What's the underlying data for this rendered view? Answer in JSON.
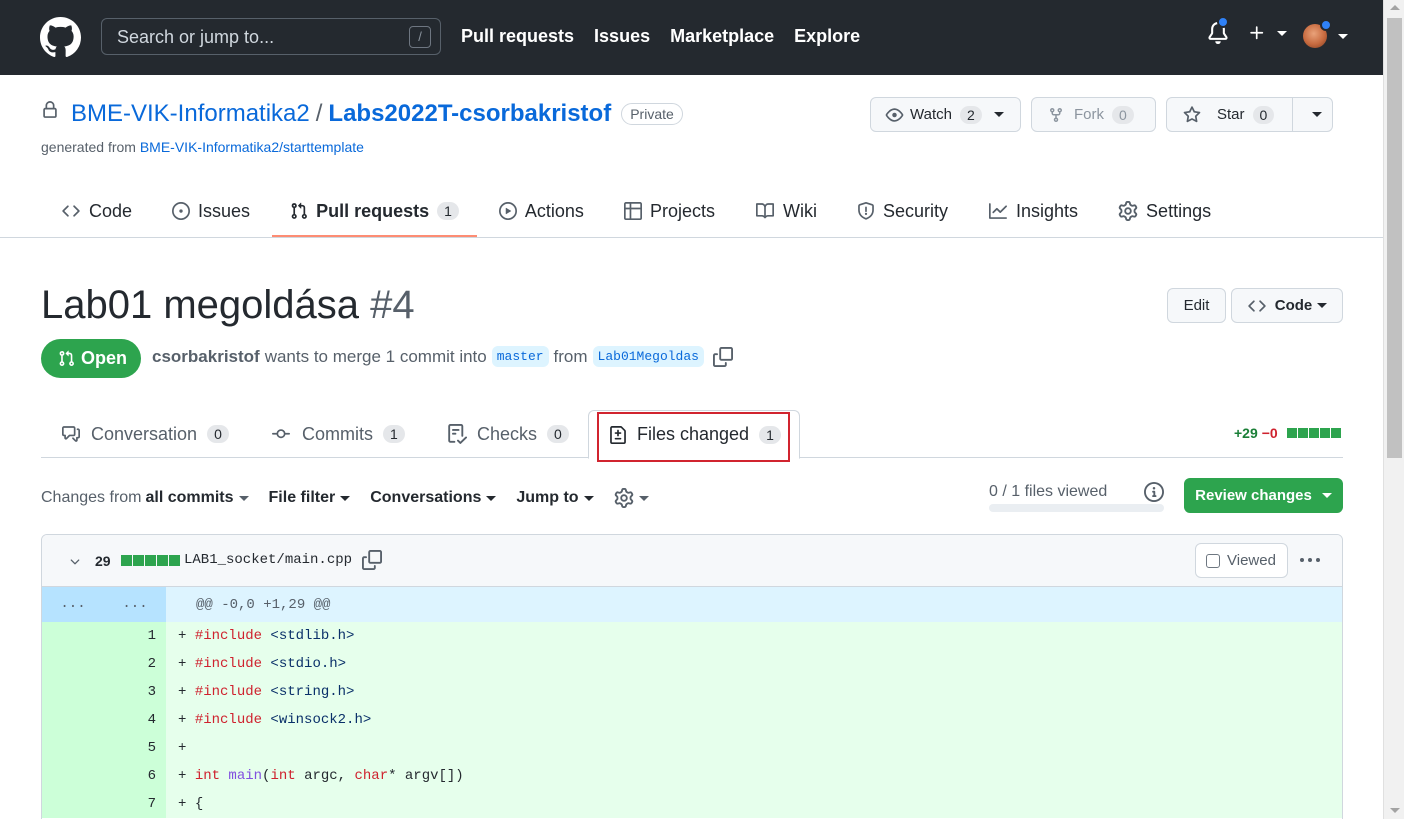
{
  "header": {
    "search_placeholder": "Search or jump to...",
    "slash_key": "/",
    "nav": [
      "Pull requests",
      "Issues",
      "Marketplace",
      "Explore"
    ]
  },
  "repo": {
    "owner": "BME-VIK-Informatika2",
    "separator": "/",
    "name": "Labs2022T-csorbakristof",
    "visibility": "Private",
    "generated_prefix": "generated from",
    "template_link": "BME-VIK-Informatika2/starttemplate",
    "watch_label": "Watch",
    "watch_count": "2",
    "fork_label": "Fork",
    "fork_count": "0",
    "star_label": "Star",
    "star_count": "0"
  },
  "repo_tabs": [
    {
      "label": "Code",
      "icon": "code-icon"
    },
    {
      "label": "Issues",
      "icon": "issue-icon"
    },
    {
      "label": "Pull requests",
      "icon": "pull-request-icon",
      "count": "1",
      "active": true
    },
    {
      "label": "Actions",
      "icon": "play-icon"
    },
    {
      "label": "Projects",
      "icon": "table-icon"
    },
    {
      "label": "Wiki",
      "icon": "book-icon"
    },
    {
      "label": "Security",
      "icon": "shield-icon"
    },
    {
      "label": "Insights",
      "icon": "graph-icon"
    },
    {
      "label": "Settings",
      "icon": "gear-icon"
    }
  ],
  "pr": {
    "title": "Lab01 megoldása",
    "number": "#4",
    "edit_label": "Edit",
    "code_label": "Code",
    "status": "Open",
    "author": "csorbakristof",
    "merge_text": "wants to merge 1 commit into",
    "base_branch": "master",
    "from_text": "from",
    "head_branch": "Lab01Megoldas"
  },
  "pr_tabs": [
    {
      "label": "Conversation",
      "count": "0",
      "icon": "comment-discussion-icon"
    },
    {
      "label": "Commits",
      "count": "1",
      "icon": "commit-icon"
    },
    {
      "label": "Checks",
      "count": "0",
      "icon": "checklist-icon"
    },
    {
      "label": "Files changed",
      "count": "1",
      "icon": "file-diff-icon",
      "active": true
    }
  ],
  "diffstat": {
    "additions": "+29",
    "deletions": "−0"
  },
  "toolbar": {
    "changes_prefix": "Changes from",
    "changes_value": "all commits",
    "file_filter": "File filter",
    "conversations": "Conversations",
    "jump_to": "Jump to",
    "files_viewed": "0 / 1 files viewed",
    "files_viewed_fraction": 0,
    "review_button": "Review changes"
  },
  "file": {
    "additions_count": "29",
    "path": "LAB1_socket/main.cpp",
    "viewed_label": "Viewed",
    "hunk_left": "...",
    "hunk_right": "...",
    "hunk_header": "@@ -0,0 +1,29 @@",
    "lines": [
      {
        "num": "1",
        "prefix": "+ ",
        "kw": "#include",
        "rest": " <stdlib.h>"
      },
      {
        "num": "2",
        "prefix": "+ ",
        "kw": "#include",
        "rest": " <stdio.h>"
      },
      {
        "num": "3",
        "prefix": "+ ",
        "kw": "#include",
        "rest": " <string.h>"
      },
      {
        "num": "4",
        "prefix": "+ ",
        "kw": "#include",
        "rest": " <winsock2.h>"
      },
      {
        "num": "5",
        "prefix": "+",
        "kw": "",
        "rest": ""
      },
      {
        "num": "6",
        "prefix": "+ ",
        "kw": "int",
        "fn": " main",
        "rest": "(",
        "kw2": "int",
        "rest2": " argc, ",
        "kw3": "char",
        "rest3": "* argv[])"
      },
      {
        "num": "7",
        "prefix": "+ ",
        "kw": "",
        "rest": "{"
      }
    ]
  },
  "colors": {
    "header_bg": "#24292f",
    "link": "#0969da",
    "green": "#2da44e",
    "highlight_box": "#d1242f",
    "addition_bg": "#e6ffec",
    "hunk_bg": "#ddf4ff"
  }
}
